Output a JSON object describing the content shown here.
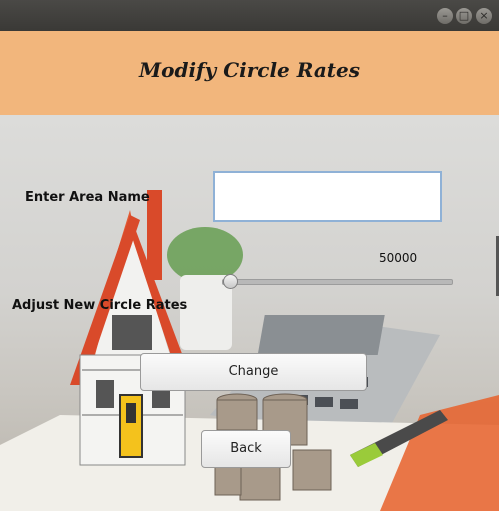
{
  "window": {
    "controls": {
      "minimize": "–",
      "maximize": "□",
      "close": "×"
    }
  },
  "header": {
    "title": "Modify Circle Rates",
    "bg_color": "#f2b67c"
  },
  "form": {
    "area_label": "Enter Area Name",
    "area_value": "",
    "rate_label": "Adjust New Circle Rates",
    "slider_value_text": "50000",
    "slider_fraction": 0.03
  },
  "buttons": {
    "change": "Change",
    "back": "Back"
  },
  "background": {
    "image": "house-model-coins-calculator-photo"
  }
}
